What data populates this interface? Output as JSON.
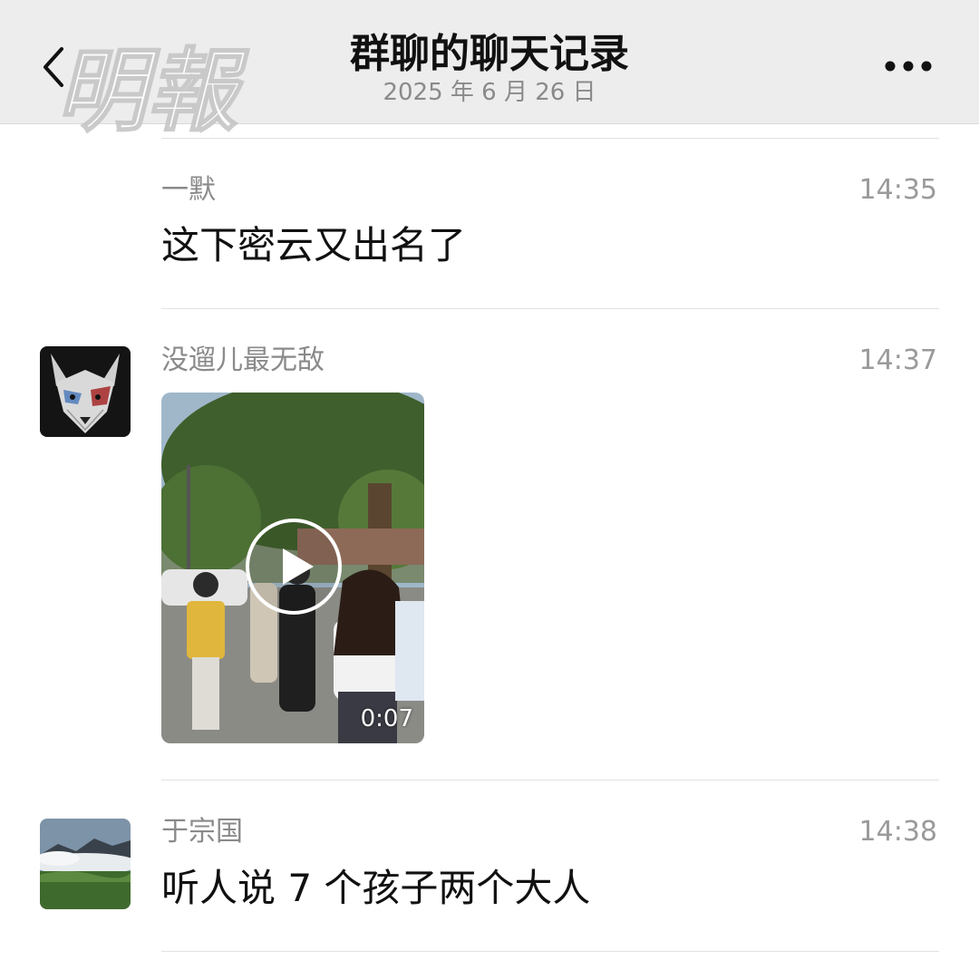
{
  "header": {
    "title": "群聊的聊天记录",
    "date": "2025 年 6 月 26 日",
    "back_icon": "chevron-left-icon",
    "more_icon": "ellipsis-icon"
  },
  "watermark": {
    "text": "明報"
  },
  "messages": [
    {
      "sender": "一默",
      "time": "14:35",
      "text": "这下密云又出名了"
    },
    {
      "sender": "没遛儿最无敌",
      "time": "14:37",
      "avatar": "wolf-avatar",
      "video_duration": "0:07"
    },
    {
      "sender": "于宗国",
      "time": "14:38",
      "avatar": "mountain-avatar",
      "text": "听人说 7 个孩子两个大人"
    }
  ],
  "colors": {
    "header_bg": "#ededed",
    "text": "#111111",
    "muted": "#8a8a8a",
    "divider": "#e2e2e2"
  }
}
